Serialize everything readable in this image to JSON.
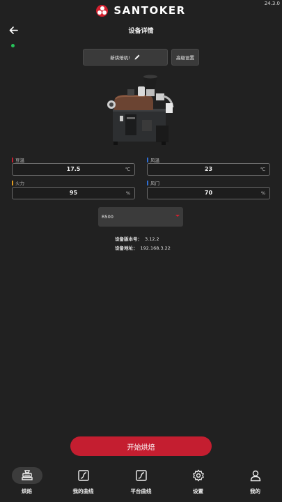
{
  "app": {
    "version": "24.3.0",
    "brand": "SANTOKER"
  },
  "header": {
    "title": "设备详情",
    "connection_status_color": "#27c35a"
  },
  "device": {
    "rename_label": "新烘焙机!",
    "advanced_label": "高级设置"
  },
  "readings": {
    "bean_temp": {
      "label": "豆温",
      "value": "17.5",
      "unit": "℃",
      "color": "#c41e30"
    },
    "air_temp": {
      "label": "风温",
      "value": "23",
      "unit": "℃",
      "color": "#2f6fd6"
    },
    "fire": {
      "label": "火力",
      "value": "95",
      "unit": "%",
      "color": "#e09a20"
    },
    "damper": {
      "label": "风门",
      "value": "70",
      "unit": "%",
      "color": "#2f6fd6"
    }
  },
  "model_select": {
    "value": "R500"
  },
  "info": {
    "version_label": "设备版本号：",
    "version_value": "3.12.2",
    "address_label": "设备地址：",
    "address_value": "192.168.3.22"
  },
  "start_button": {
    "label": "开始烘焙"
  },
  "nav": {
    "items": [
      {
        "label": "烘焙",
        "icon": "roaster-icon",
        "active": true
      },
      {
        "label": "我的曲线",
        "icon": "curve-icon"
      },
      {
        "label": "平台曲线",
        "icon": "platform-curve-icon"
      },
      {
        "label": "设置",
        "icon": "gear-icon"
      },
      {
        "label": "我的",
        "icon": "user-icon"
      }
    ]
  },
  "colors": {
    "accent": "#c41e30",
    "background": "#212121"
  }
}
